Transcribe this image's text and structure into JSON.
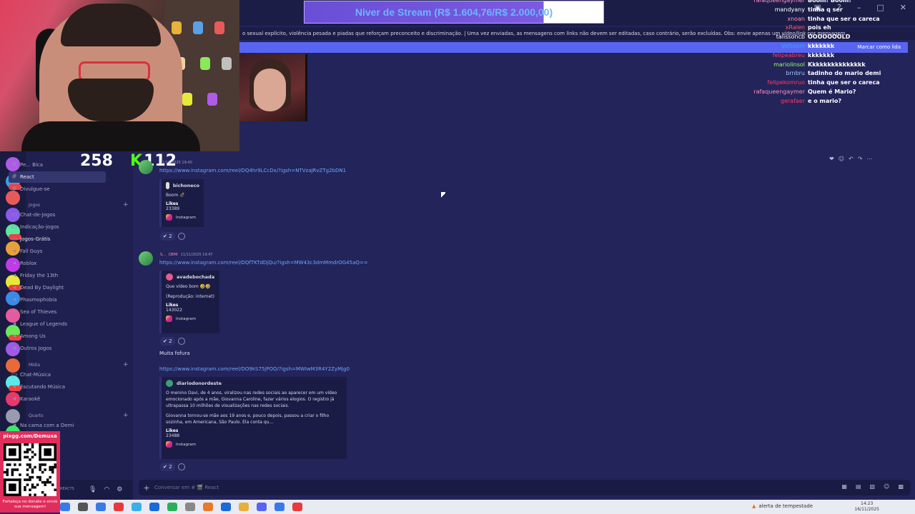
{
  "stream_goal": {
    "label": "Niver de Stream (R$ 1.604,76/R$ 2.000,00)"
  },
  "rules_text": "o sexual explícito, violência pesada e piadas que reforçam preconceito e discriminação.  | Uma vez enviadas, as mensagens com links não devem ser editadas, caso contrário, serão excluídas. Obs: envie apenas um vídeo/link por mensagem",
  "mark_read_label": "Marcar como lida",
  "counters": {
    "viewers": "258",
    "kick": "112"
  },
  "chat": [
    {
      "user": "rafaqueengaymer",
      "msg": "Boom! Boom!",
      "color": "#ff8fbf"
    },
    {
      "user": "mandyany",
      "msg": "tinha q ser",
      "color": "#ffffff"
    },
    {
      "user": "xnoan",
      "msg": "tinha que ser o careca",
      "color": "#ff8fbf"
    },
    {
      "user": "xRalen",
      "msg": "pois eh",
      "color": "#ff5a5a"
    },
    {
      "user": "talissoncb",
      "msg": "OOOOOOOLD",
      "color": "#ffffff"
    },
    {
      "user": "Vettoom",
      "msg": "kkkkkkk",
      "color": "#3aa0ff"
    },
    {
      "user": "felipeabreu",
      "msg": "kkkkkkk",
      "color": "#ff3a6a"
    },
    {
      "user": "mariolinsol",
      "msg": "Kkkkkkkkkkkkkkk",
      "color": "#9bff6a"
    },
    {
      "user": "brnbru",
      "msg": "tadinho do mario demi",
      "color": "#a0c8ff"
    },
    {
      "user": "felipekomruo",
      "msg": "tinha que ser o careca",
      "color": "#ff3a6a"
    },
    {
      "user": "rafaqueengaymer",
      "msg": "Quem é Mario?",
      "color": "#ff8fbf"
    },
    {
      "user": "gerafaer",
      "msg": "e o mario?",
      "color": "#ff3a6a"
    }
  ],
  "channels": {
    "top": [
      {
        "label": "Pe... Bica",
        "sym": "#"
      },
      {
        "label": "React",
        "sym": "#"
      },
      {
        "label": "Divulgue-se",
        "sym": "#"
      }
    ],
    "cat_jogos": "Jogos",
    "jogos": [
      {
        "label": "Chat-de-Jogos",
        "sym": "▭"
      },
      {
        "label": "Indicação-jogos",
        "sym": "▭"
      },
      {
        "label": "Jogos-Grátis",
        "sym": "▭"
      },
      {
        "label": "Fall Guys",
        "sym": "◂"
      },
      {
        "label": "Roblox",
        "sym": "◂"
      },
      {
        "label": "Friday the 13th",
        "sym": "◂"
      },
      {
        "label": "Dead By Daylight",
        "sym": "◂"
      },
      {
        "label": "Phasmophobia",
        "sym": "◂"
      },
      {
        "label": "Sea of Thieves",
        "sym": "◂"
      },
      {
        "label": "League of Legends",
        "sym": "◂"
      },
      {
        "label": "Among Us",
        "sym": "◂"
      },
      {
        "label": "Outros Jogos",
        "sym": "◂"
      }
    ],
    "cat_midia": "Mídia",
    "midia": [
      {
        "label": "Chat-Música",
        "sym": "▭"
      },
      {
        "label": "Escutando Música",
        "sym": "◂"
      },
      {
        "label": "Karaokê",
        "sym": "◂"
      }
    ],
    "cat_quarto": "Quarto",
    "quarto": [
      {
        "label": "Na cama com a Demi",
        "sym": "◂"
      }
    ]
  },
  "qr": {
    "url": "pixgg.com/Demuxa",
    "caption": "Fortaleça no donate e envie sua mensagem!"
  },
  "user_panel": {
    "tag": "REACTS"
  },
  "messages": {
    "m1": {
      "time": "11/11/2025 19:40",
      "link": "https://www.instagram.com/reel/DQ4hr9LCcDx/?igsh=NTVzaJRvZTg2bDN1",
      "author": "bichoneco",
      "desc": "Boom 💣",
      "likes_label": "Likes",
      "likes": "23389",
      "footer": "Instagram",
      "reaction_count": "2"
    },
    "m2": {
      "name": "S...",
      "badge": "DEMI",
      "time": "11/11/2025 19:47",
      "link": "https://www.instagram.com/reel/DQfTKTdDjQu/?igsh=MW43c3dmMmdrOG45aQ==",
      "author": "avadebochada",
      "desc1": "Que vídeo bom 🤣🤣",
      "desc2": "(Reprodução: internet)",
      "likes_label": "Likes",
      "likes": "143022",
      "footer": "Instagram",
      "reaction_count": "2"
    },
    "m3": {
      "text": "Muita fofura",
      "link": "https://www.instagram.com/reel/DO9kS75jPOO/?igsh=MWIwM3R4Y2ZyMjg0",
      "author": "diariodonordeste",
      "desc1": "O menino Davi, de 4 anos, viralizou nas redes sociais ao aparecer em um vídeo emocionado após a mãe, Giovanna Caroline, fazer vários elogios. O registro já ultrapassa 10 milhões de visualizações nas redes sociais.",
      "desc2": "Giovanna tornou-se mãe aos 19 anos e, pouco depois, passou a criar o filho sozinha, em Americana, São Paulo. Ela conta qu...",
      "likes_label": "Likes",
      "likes": "23488",
      "footer": "Instagram",
      "reaction_count": "2"
    }
  },
  "composer_placeholder": "Conversar em # 🎬 React",
  "taskbar": {
    "weather": "alerta de tempestade",
    "time": "14:23",
    "date": "16/11/2025"
  },
  "colors": {
    "accent": "#5865f2",
    "bg": "#23245a",
    "link": "#6ea8ff",
    "qr_bg": "#e12d5c"
  }
}
